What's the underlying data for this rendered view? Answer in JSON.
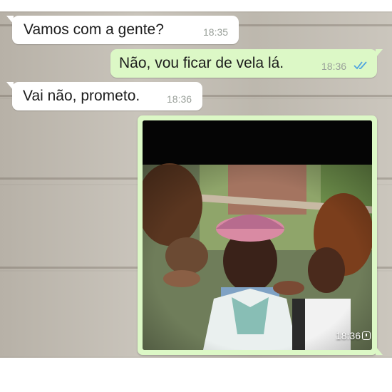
{
  "messages": [
    {
      "direction": "incoming",
      "text": "Vamos com a gente?",
      "time": "18:35"
    },
    {
      "direction": "outgoing",
      "text": "Não, vou ficar de vela lá.",
      "time": "18:36",
      "status": "read"
    },
    {
      "direction": "incoming",
      "text": "Vai não, prometo.",
      "time": "18:36"
    }
  ],
  "media_message": {
    "direction": "outgoing",
    "type": "photo",
    "time": "18:36",
    "status": "pending"
  },
  "colors": {
    "incoming_bubble": "#ffffff",
    "outgoing_bubble": "#dcf8c6",
    "read_ticks": "#4fa3e0",
    "timestamp": "#9aa09a"
  },
  "icons": {
    "read_status": "double-check-icon",
    "pending_status": "clock-icon"
  }
}
